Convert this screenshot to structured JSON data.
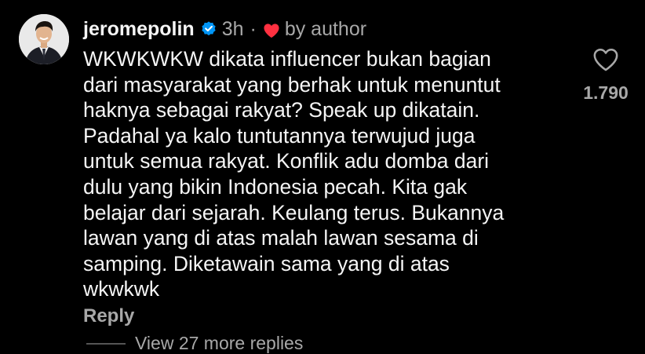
{
  "comment": {
    "username": "jeromepolin",
    "verified_icon": "verified-badge-icon",
    "time": "3h",
    "separator": "·",
    "liked_by_author_icon": "heart-filled-icon",
    "liked_by_label": "by author",
    "text_lines": [
      "WKWKWKW dikata influencer bukan bagian",
      "dari masyarakat yang berhak untuk menuntut",
      "haknya sebagai rakyat? Speak up dikatain.",
      "Padahal ya kalo tuntutannya terwujud juga",
      "untuk semua rakyat. Konflik adu domba dari",
      "dulu yang bikin Indonesia pecah. Kita gak",
      "belajar dari sejarah. Keulang terus. Bukannya",
      "lawan yang di atas malah lawan sesama di",
      "samping. Diketawain sama yang di atas",
      "wkwkwk"
    ],
    "reply_label": "Reply",
    "like_icon": "heart-outline-icon",
    "like_count": "1.790",
    "view_replies_label": "View 27 more replies"
  },
  "colors": {
    "background": "#000000",
    "primary_text": "#f5f5f5",
    "secondary_text": "#a8a8a8",
    "verified_blue": "#0095f6",
    "heart_red": "#ff3040"
  }
}
